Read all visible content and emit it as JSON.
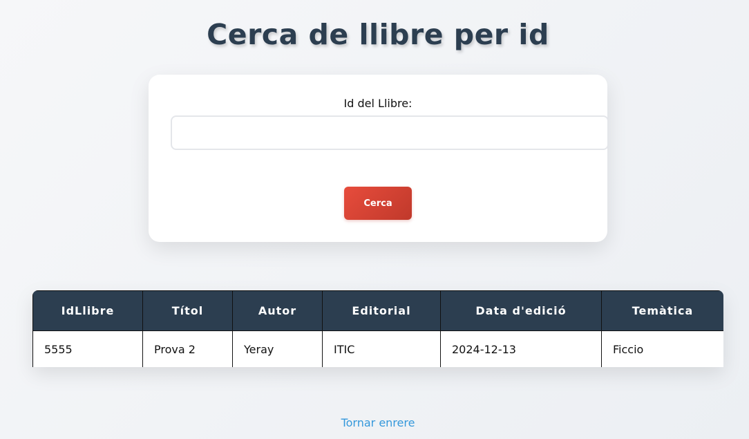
{
  "page": {
    "title": "Cerca de llibre per id"
  },
  "search": {
    "label": "Id del Llibre:",
    "value": "",
    "button_label": "Cerca"
  },
  "table": {
    "headers": [
      "IdLlibre",
      "Títol",
      "Autor",
      "Editorial",
      "Data d'edició",
      "Temàtica"
    ],
    "rows": [
      [
        "5555",
        "Prova 2",
        "Yeray",
        "ITIC",
        "2024-12-13",
        "Ficcio"
      ]
    ]
  },
  "footer": {
    "back_link": "Tornar enrere"
  },
  "colors": {
    "header_bg": "#2c3e50",
    "button": "#e74c3c",
    "link": "#3498db"
  }
}
